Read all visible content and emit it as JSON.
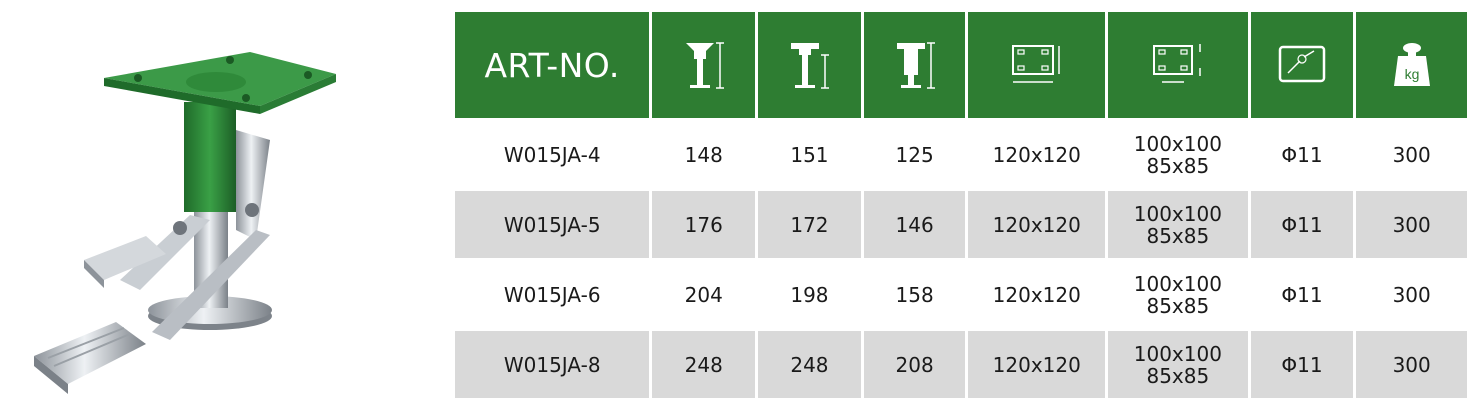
{
  "table": {
    "header": {
      "art_no_label": "ART-NO.",
      "icons": [
        "overall-height-icon",
        "stem-height-icon",
        "lift-height-icon",
        "plate-size-icon",
        "bolt-hole-spacing-icon",
        "bolt-hole-diameter-icon",
        "load-capacity-icon"
      ],
      "load_unit": "kg"
    },
    "rows": [
      {
        "art": "W015JA-4",
        "h1": "148",
        "h2": "151",
        "h3": "125",
        "plate": "120x120",
        "holes_a": "100x100",
        "holes_b": "85x85",
        "bolt": "Φ11",
        "load": "300"
      },
      {
        "art": "W015JA-5",
        "h1": "176",
        "h2": "172",
        "h3": "146",
        "plate": "120x120",
        "holes_a": "100x100",
        "holes_b": "85x85",
        "bolt": "Φ11",
        "load": "300"
      },
      {
        "art": "W015JA-6",
        "h1": "204",
        "h2": "198",
        "h3": "158",
        "plate": "120x120",
        "holes_a": "100x100",
        "holes_b": "85x85",
        "bolt": "Φ11",
        "load": "300"
      },
      {
        "art": "W015JA-8",
        "h1": "248",
        "h2": "248",
        "h3": "208",
        "plate": "120x120",
        "holes_a": "100x100",
        "holes_b": "85x85",
        "bolt": "Φ11",
        "load": "300"
      }
    ]
  },
  "colors": {
    "header_green": "#2e7d32",
    "alt_row_gray": "#d9d9d9",
    "product_green": "#2f8a3a"
  }
}
